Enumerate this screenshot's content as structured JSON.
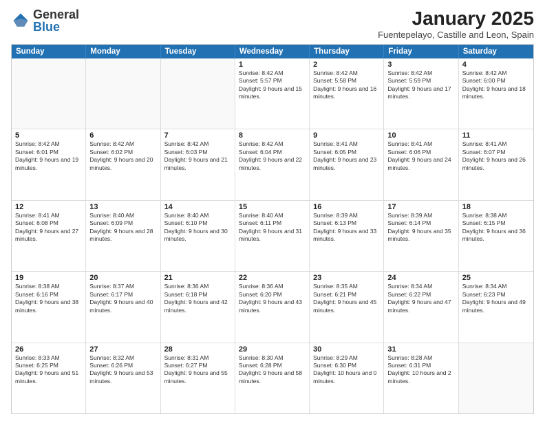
{
  "header": {
    "logo_general": "General",
    "logo_blue": "Blue",
    "month_title": "January 2025",
    "subtitle": "Fuentepelayo, Castille and Leon, Spain"
  },
  "weekdays": [
    "Sunday",
    "Monday",
    "Tuesday",
    "Wednesday",
    "Thursday",
    "Friday",
    "Saturday"
  ],
  "rows": [
    [
      {
        "day": "",
        "info": "",
        "empty": true
      },
      {
        "day": "",
        "info": "",
        "empty": true
      },
      {
        "day": "",
        "info": "",
        "empty": true
      },
      {
        "day": "1",
        "info": "Sunrise: 8:42 AM\nSunset: 5:57 PM\nDaylight: 9 hours and 15 minutes."
      },
      {
        "day": "2",
        "info": "Sunrise: 8:42 AM\nSunset: 5:58 PM\nDaylight: 9 hours and 16 minutes."
      },
      {
        "day": "3",
        "info": "Sunrise: 8:42 AM\nSunset: 5:59 PM\nDaylight: 9 hours and 17 minutes."
      },
      {
        "day": "4",
        "info": "Sunrise: 8:42 AM\nSunset: 6:00 PM\nDaylight: 9 hours and 18 minutes."
      }
    ],
    [
      {
        "day": "5",
        "info": "Sunrise: 8:42 AM\nSunset: 6:01 PM\nDaylight: 9 hours and 19 minutes."
      },
      {
        "day": "6",
        "info": "Sunrise: 8:42 AM\nSunset: 6:02 PM\nDaylight: 9 hours and 20 minutes."
      },
      {
        "day": "7",
        "info": "Sunrise: 8:42 AM\nSunset: 6:03 PM\nDaylight: 9 hours and 21 minutes."
      },
      {
        "day": "8",
        "info": "Sunrise: 8:42 AM\nSunset: 6:04 PM\nDaylight: 9 hours and 22 minutes."
      },
      {
        "day": "9",
        "info": "Sunrise: 8:41 AM\nSunset: 6:05 PM\nDaylight: 9 hours and 23 minutes."
      },
      {
        "day": "10",
        "info": "Sunrise: 8:41 AM\nSunset: 6:06 PM\nDaylight: 9 hours and 24 minutes."
      },
      {
        "day": "11",
        "info": "Sunrise: 8:41 AM\nSunset: 6:07 PM\nDaylight: 9 hours and 26 minutes."
      }
    ],
    [
      {
        "day": "12",
        "info": "Sunrise: 8:41 AM\nSunset: 6:08 PM\nDaylight: 9 hours and 27 minutes."
      },
      {
        "day": "13",
        "info": "Sunrise: 8:40 AM\nSunset: 6:09 PM\nDaylight: 9 hours and 28 minutes."
      },
      {
        "day": "14",
        "info": "Sunrise: 8:40 AM\nSunset: 6:10 PM\nDaylight: 9 hours and 30 minutes."
      },
      {
        "day": "15",
        "info": "Sunrise: 8:40 AM\nSunset: 6:11 PM\nDaylight: 9 hours and 31 minutes."
      },
      {
        "day": "16",
        "info": "Sunrise: 8:39 AM\nSunset: 6:13 PM\nDaylight: 9 hours and 33 minutes."
      },
      {
        "day": "17",
        "info": "Sunrise: 8:39 AM\nSunset: 6:14 PM\nDaylight: 9 hours and 35 minutes."
      },
      {
        "day": "18",
        "info": "Sunrise: 8:38 AM\nSunset: 6:15 PM\nDaylight: 9 hours and 36 minutes."
      }
    ],
    [
      {
        "day": "19",
        "info": "Sunrise: 8:38 AM\nSunset: 6:16 PM\nDaylight: 9 hours and 38 minutes."
      },
      {
        "day": "20",
        "info": "Sunrise: 8:37 AM\nSunset: 6:17 PM\nDaylight: 9 hours and 40 minutes."
      },
      {
        "day": "21",
        "info": "Sunrise: 8:36 AM\nSunset: 6:18 PM\nDaylight: 9 hours and 42 minutes."
      },
      {
        "day": "22",
        "info": "Sunrise: 8:36 AM\nSunset: 6:20 PM\nDaylight: 9 hours and 43 minutes."
      },
      {
        "day": "23",
        "info": "Sunrise: 8:35 AM\nSunset: 6:21 PM\nDaylight: 9 hours and 45 minutes."
      },
      {
        "day": "24",
        "info": "Sunrise: 8:34 AM\nSunset: 6:22 PM\nDaylight: 9 hours and 47 minutes."
      },
      {
        "day": "25",
        "info": "Sunrise: 8:34 AM\nSunset: 6:23 PM\nDaylight: 9 hours and 49 minutes."
      }
    ],
    [
      {
        "day": "26",
        "info": "Sunrise: 8:33 AM\nSunset: 6:25 PM\nDaylight: 9 hours and 51 minutes."
      },
      {
        "day": "27",
        "info": "Sunrise: 8:32 AM\nSunset: 6:26 PM\nDaylight: 9 hours and 53 minutes."
      },
      {
        "day": "28",
        "info": "Sunrise: 8:31 AM\nSunset: 6:27 PM\nDaylight: 9 hours and 55 minutes."
      },
      {
        "day": "29",
        "info": "Sunrise: 8:30 AM\nSunset: 6:28 PM\nDaylight: 9 hours and 58 minutes."
      },
      {
        "day": "30",
        "info": "Sunrise: 8:29 AM\nSunset: 6:30 PM\nDaylight: 10 hours and 0 minutes."
      },
      {
        "day": "31",
        "info": "Sunrise: 8:28 AM\nSunset: 6:31 PM\nDaylight: 10 hours and 2 minutes."
      },
      {
        "day": "",
        "info": "",
        "empty": true
      }
    ]
  ]
}
